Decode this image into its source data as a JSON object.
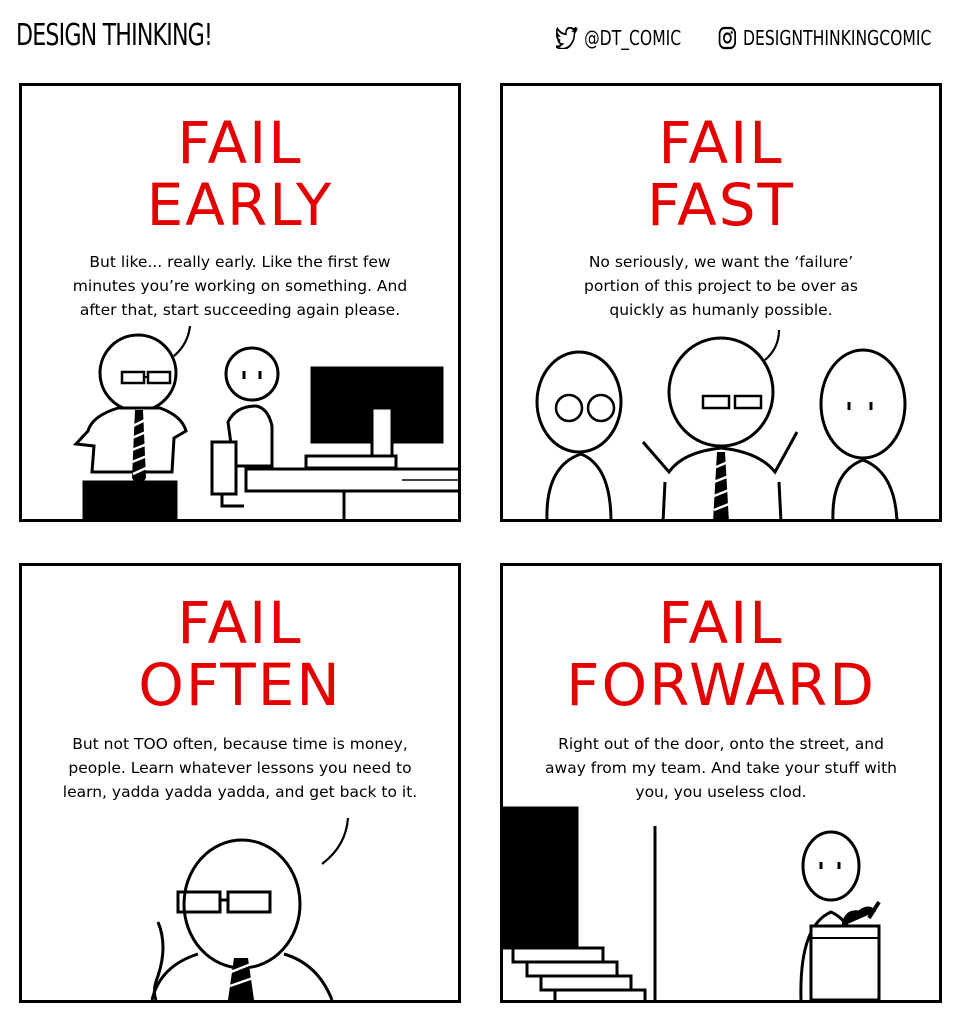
{
  "header": {
    "title": "DESIGN THINKING!",
    "twitter_handle": "@DT_COMIC",
    "instagram_handle": "DESIGNTHINKINGCOMIC"
  },
  "panels": [
    {
      "headline_line1": "FAIL",
      "headline_line2": "EARLY",
      "caption_lines": [
        "But like... really early. Like the first few",
        "minutes you’re working on something. And",
        "after that, start succeeding again please."
      ]
    },
    {
      "headline_line1": "FAIL",
      "headline_line2": "FAST",
      "caption_lines": [
        "No seriously, we want the ‘failure’",
        "portion of this project to be over as",
        "quickly as humanly possible."
      ]
    },
    {
      "headline_line1": "FAIL",
      "headline_line2": "OFTEN",
      "caption_lines": [
        "But not TOO often, because time is money,",
        "people. Learn whatever lessons you need to",
        "learn, yadda yadda yadda, and get back to it."
      ]
    },
    {
      "headline_line1": "FAIL",
      "headline_line2": "FORWARD",
      "caption_lines": [
        "Right out of the door, onto the street, and",
        "away from my team. And take your stuff with",
        "you, you useless clod."
      ]
    }
  ],
  "colors": {
    "headline": "#e40000",
    "ink": "#000000",
    "paper": "#ffffff"
  },
  "icons": {
    "twitter": "twitter-bird-icon",
    "instagram": "instagram-camera-icon"
  }
}
